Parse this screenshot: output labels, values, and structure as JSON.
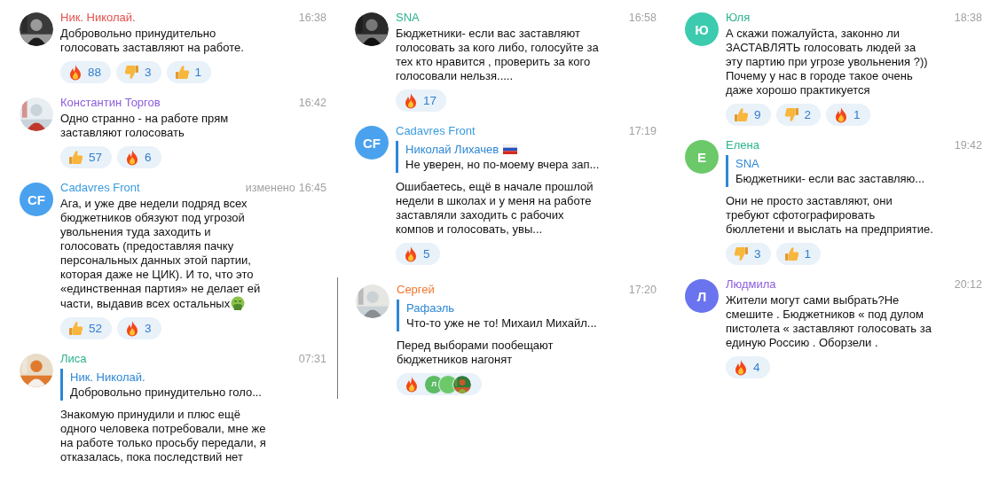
{
  "columns": [
    {
      "messages": [
        {
          "avatar": {
            "kind": "picture"
          },
          "name": "Ник. Николай.",
          "color": "#e5504c",
          "time": "16:38",
          "text": "Добровольно принудительно голосовать  заставляют  на работе.",
          "reactions": [
            {
              "kind": "fire",
              "count": "88"
            },
            {
              "kind": "thumbs-down",
              "count": "3"
            },
            {
              "kind": "thumbs-up",
              "count": "1"
            }
          ]
        },
        {
          "avatar": {
            "kind": "picture"
          },
          "name": "Константин Торгов",
          "color": "#8c5ddd",
          "time": "16:42",
          "text": "Одно странно - на работе прям заставляют голосовать",
          "reactions": [
            {
              "kind": "thumbs-up",
              "count": "57"
            },
            {
              "kind": "fire",
              "count": "6"
            }
          ]
        },
        {
          "avatar": {
            "kind": "initials",
            "initials": "CF",
            "color": "#4aa2ee"
          },
          "name": "Cadavres Front",
          "color": "#3a9be0",
          "edited_label": "изменено",
          "time": "16:45",
          "text": "Ага, и уже две недели подряд всех бюджетников обязуют под угрозой увольнения туда заходить и голосовать (предоставляя пачку персональных данных этой партии, которая даже не ЦИК). И то, что это «единственная партия» не делает ей части, выдавив всех остальных",
          "sick_emoji": true,
          "reactions": [
            {
              "kind": "thumbs-up",
              "count": "52"
            },
            {
              "kind": "fire",
              "count": "3"
            }
          ]
        },
        {
          "avatar": {
            "kind": "picture"
          },
          "name": "Лиса",
          "color": "#2cb38e",
          "time": "07:31",
          "reply": {
            "name": "Ник. Николай.",
            "text": "Добровольно принудительно голо..."
          },
          "text": "Знакомую принудили и плюс ещё одного человека потребовали, мне же на работе только просьбу передали, я отказалась, пока последствий нет"
        }
      ]
    },
    {
      "messages": [
        {
          "avatar": {
            "kind": "picture"
          },
          "name": "SNA",
          "color": "#2cb38e",
          "time": "16:58",
          "text": "Бюджетники- если вас заставляют голосовать за кого либо, голосуйте за тех кто нравится , проверить за кого голосовали нельзя.....",
          "reactions": [
            {
              "kind": "fire",
              "count": "17"
            }
          ]
        },
        {
          "avatar": {
            "kind": "initials",
            "initials": "CF",
            "color": "#4aa2ee"
          },
          "name": "Cadavres Front",
          "color": "#3a9be0",
          "time": "17:19",
          "reply": {
            "name": "Николай Лихачев",
            "flag": true,
            "text": "Не уверен, но по-моему вчера зап..."
          },
          "text": "Ошибаетесь, ещё в начале прошлой недели в школах и у меня на работе заставляли заходить с рабочих компов и голосовать, увы...",
          "reactions": [
            {
              "kind": "fire",
              "count": "5"
            }
          ]
        },
        {
          "avatar": {
            "kind": "picture"
          },
          "name": "Сергей",
          "color": "#f2762e",
          "time": "17:20",
          "divider": true,
          "reply": {
            "name": "Рафаэль",
            "text": "Что-то уже не то! Михаил Михайл..."
          },
          "text": "Перед выборами пообещают бюджетников нагонят",
          "reactions": [
            {
              "kind": "fire",
              "reactors": [
                {
                  "kind": "initials",
                  "initials": "Л",
                  "color": "#5dbb63"
                },
                {
                  "kind": "initials",
                  "color": "#6cc96a"
                },
                {
                  "kind": "picture"
                }
              ]
            }
          ]
        }
      ]
    },
    {
      "messages": [
        {
          "avatar": {
            "kind": "initials",
            "initials": "Ю",
            "color": "#3ccbae"
          },
          "name": "Юля",
          "color": "#2cb38e",
          "time": "18:38",
          "text": "А скажи пожалуйста, законно ли ЗАСТАВЛЯТЬ голосовать людей за эту партию при угрозе увольнения ?)) Почему у нас в городе такое очень даже хорошо практикуется",
          "reactions": [
            {
              "kind": "thumbs-up",
              "count": "9"
            },
            {
              "kind": "thumbs-down",
              "count": "2"
            },
            {
              "kind": "fire",
              "count": "1"
            }
          ]
        },
        {
          "avatar": {
            "kind": "initials",
            "initials": "Е",
            "color": "#6cc96a"
          },
          "name": "Елена",
          "color": "#2cb38e",
          "time": "19:42",
          "reply": {
            "name": "SNA",
            "text": "Бюджетники- если вас заставляю..."
          },
          "text": "Они не просто заставляют, они требуют сфотографировать бюллетени и выслать на предприятие.",
          "reactions": [
            {
              "kind": "thumbs-down",
              "count": "3"
            },
            {
              "kind": "thumbs-up",
              "count": "1"
            }
          ]
        },
        {
          "avatar": {
            "kind": "initials",
            "initials": "Л",
            "color": "#6a74ee"
          },
          "name": "Людмила",
          "color": "#8c5ddd",
          "time": "20:12",
          "text": "Жители могут сами выбрать?Не смешите . Бюджетников « под дулом пистолета « заставляют голосовать за единую Россию . Оборзели .",
          "reactions": [
            {
              "kind": "fire",
              "count": "4"
            }
          ]
        }
      ]
    }
  ]
}
